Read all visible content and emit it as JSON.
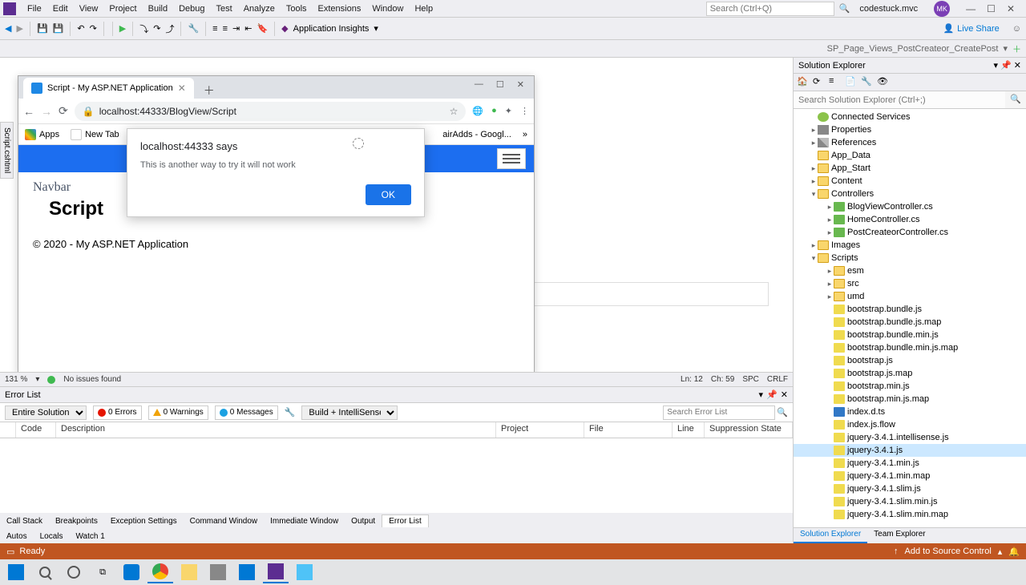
{
  "vs": {
    "menus": [
      "File",
      "Edit",
      "View",
      "Project",
      "Build",
      "Debug",
      "Test",
      "Analyze",
      "Tools",
      "Extensions",
      "Window",
      "Help"
    ],
    "search_ph": "Search (Ctrl+Q)",
    "solution_name": "codestuck.mvc",
    "avatar": "MK",
    "liveshare": "Live Share",
    "insights": "Application Insights",
    "crumb_right": "SP_Page_Views_PostCreateor_CreatePost"
  },
  "browser": {
    "tab_title": "Script - My ASP.NET Application",
    "url": "localhost:44333/BlogView/Script",
    "bookmarks": {
      "apps": "Apps",
      "newtab": "New Tab",
      "adds": "airAdds - Googl..."
    },
    "page": {
      "brand": "Navbar",
      "title": "Script",
      "footer": "© 2020 - My ASP.NET Application"
    }
  },
  "alert": {
    "title": "localhost:44333 says",
    "message": "This is another way to try it will not work",
    "ok": "OK"
  },
  "editor_status": {
    "zoom": "131 %",
    "issues": "No issues found",
    "ln": "Ln: 12",
    "ch": "Ch: 59",
    "spc": "SPC",
    "crlf": "CRLF"
  },
  "errorlist": {
    "title": "Error List",
    "scope": "Entire Solution",
    "errors": "0 Errors",
    "warnings": "0 Warnings",
    "messages": "0 Messages",
    "build": "Build + IntelliSense",
    "search_ph": "Search Error List",
    "cols": {
      "code": "Code",
      "desc": "Description",
      "project": "Project",
      "file": "File",
      "line": "Line",
      "supp": "Suppression State"
    }
  },
  "bottom_tabs": [
    "Call Stack",
    "Breakpoints",
    "Exception Settings",
    "Command Window",
    "Immediate Window",
    "Output",
    "Error List"
  ],
  "bottom_tabs2": [
    "Autos",
    "Locals",
    "Watch 1"
  ],
  "sol": {
    "title": "Solution Explorer",
    "search_ph": "Search Solution Explorer (Ctrl+;)",
    "tree": {
      "connected": "Connected Services",
      "properties": "Properties",
      "references": "References",
      "app_data": "App_Data",
      "app_start": "App_Start",
      "content": "Content",
      "controllers": "Controllers",
      "c1": "BlogViewController.cs",
      "c2": "HomeController.cs",
      "c3": "PostCreateorController.cs",
      "images": "Images",
      "scripts": "Scripts",
      "esm": "esm",
      "src": "src",
      "umd": "umd",
      "f1": "bootstrap.bundle.js",
      "f2": "bootstrap.bundle.js.map",
      "f3": "bootstrap.bundle.min.js",
      "f4": "bootstrap.bundle.min.js.map",
      "f5": "bootstrap.js",
      "f6": "bootstrap.js.map",
      "f7": "bootstrap.min.js",
      "f8": "bootstrap.min.js.map",
      "f9": "index.d.ts",
      "f10": "index.js.flow",
      "f11": "jquery-3.4.1.intellisense.js",
      "f12": "jquery-3.4.1.js",
      "f13": "jquery-3.4.1.min.js",
      "f14": "jquery-3.4.1.min.map",
      "f15": "jquery-3.4.1.slim.js",
      "f16": "jquery-3.4.1.slim.min.js",
      "f17": "jquery-3.4.1.slim.min.map"
    },
    "tabs": {
      "se": "Solution Explorer",
      "te": "Team Explorer"
    }
  },
  "status": {
    "ready": "Ready",
    "add_sc": "Add to Source Control"
  },
  "side_tab": "Script.cshtml"
}
